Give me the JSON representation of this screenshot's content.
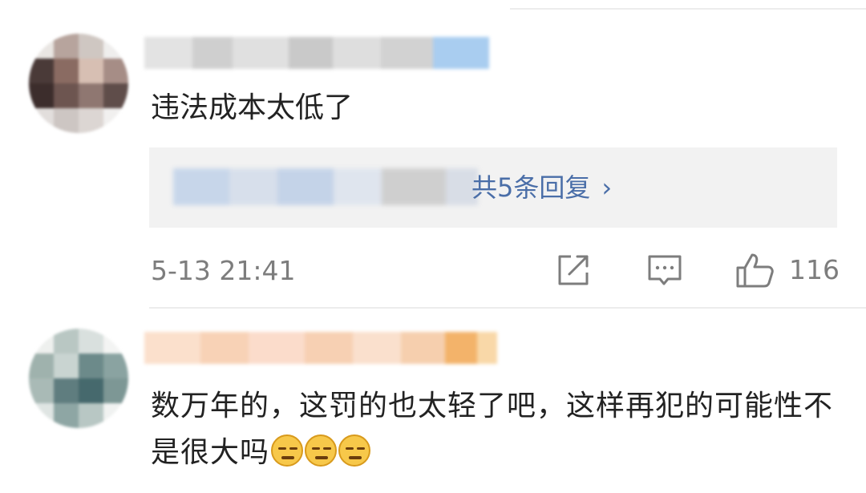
{
  "comments": [
    {
      "text": "违法成本太低了",
      "reply_summary": "共5条回复",
      "reply_chevron": "›",
      "timestamp": "5-13 21:41",
      "like_count": "116",
      "avatar_icon": "blurred-avatar",
      "username_state": "blurred"
    },
    {
      "text_main": "数万年的，这罚的也太轻了吧，这样再犯的可能性不是很大吗",
      "emoji": [
        "sweat-smile-emoji",
        "sweat-smile-emoji",
        "sweat-smile-emoji"
      ],
      "avatar_icon": "blurred-avatar",
      "username_state": "blurred"
    }
  ],
  "icons": {
    "share": "edit-share-icon",
    "comment": "comment-bubble-icon",
    "like": "thumbs-up-icon"
  },
  "colors": {
    "text": "#222222",
    "meta": "#7d7d7d",
    "link": "#4a6ea8",
    "reply_bg": "#f2f2f2",
    "divider": "#ececec"
  }
}
